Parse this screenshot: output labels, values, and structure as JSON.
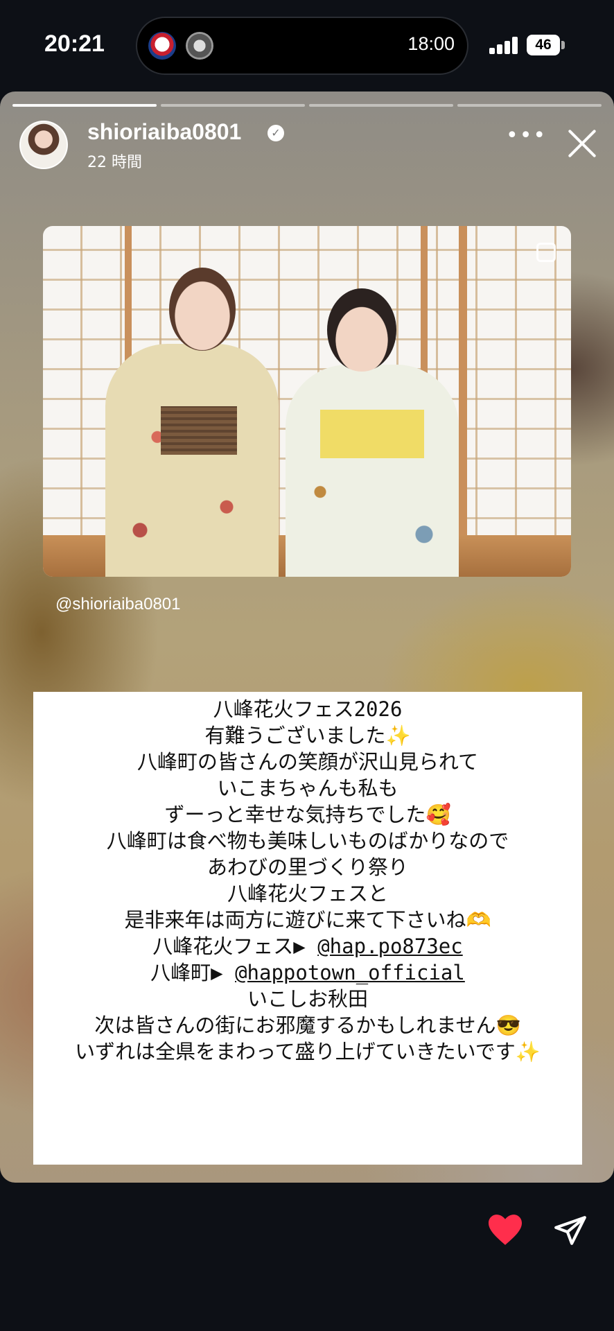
{
  "status_bar": {
    "time": "20:21",
    "island_time": "18:00",
    "battery": "46"
  },
  "story": {
    "username": "shioriaiba0801",
    "time_ago": "22 時間",
    "progress_segments": 4,
    "progress_done": 1,
    "photo_credit": "@shioriaiba0801",
    "text_lines": [
      "八峰花火フェス2026",
      "有難うございました✨",
      "八峰町の皆さんの笑顔が沢山見られて",
      "いこまちゃんも私も",
      "ずーっと幸せな気持ちでした🥰",
      "八峰町は食べ物も美味しいものばかりなので",
      "あわびの里づくり祭り",
      "八峰花火フェスと",
      "是非来年は両方に遊びに来て下さいね🫶"
    ],
    "link_line_1": {
      "prefix": "八峰花火フェス▶ ",
      "link": "@hap.po873ec"
    },
    "link_line_2": {
      "prefix": "八峰町▶ ",
      "link": "@happotown_official"
    },
    "tail_lines": [
      "いこしお秋田",
      "次は皆さんの街にお邪魔するかもしれません😎",
      "いずれは全県をまわって盛り上げていきたいです✨"
    ]
  },
  "colors": {
    "heart": "#ff2e4c",
    "background": "#0d1016"
  },
  "icons": [
    "more-icon",
    "close-icon",
    "copy-icon",
    "heart-icon",
    "send-icon",
    "verified-badge-icon"
  ]
}
